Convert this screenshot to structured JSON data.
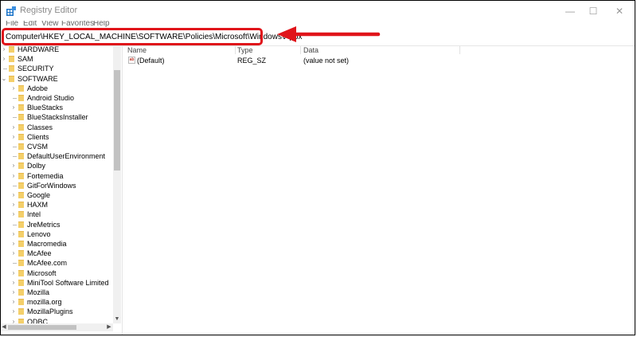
{
  "window": {
    "title": "Registry Editor",
    "icon": "registry-editor-icon",
    "controls": [
      "minimize",
      "maximize",
      "close"
    ],
    "control_glyphs": [
      "—",
      "☐",
      "✕"
    ]
  },
  "menu": [
    "File",
    "Edit",
    "View",
    "Favorites",
    "Help"
  ],
  "address": {
    "path": "Computer\\HKEY_LOCAL_MACHINE\\SOFTWARE\\Policies\\Microsoft\\Windows\\Appx"
  },
  "annotation": {
    "highlight_color": "#e0141a",
    "arrow_color": "#e0141a"
  },
  "tree": {
    "items": [
      {
        "label": "HARDWARE",
        "level": 1,
        "expander": "collapsed"
      },
      {
        "label": "SAM",
        "level": 1,
        "expander": "collapsed"
      },
      {
        "label": "SECURITY",
        "level": 1,
        "expander": "none"
      },
      {
        "label": "SOFTWARE",
        "level": 1,
        "expander": "expanded"
      },
      {
        "label": "Adobe",
        "level": 2,
        "expander": "collapsed"
      },
      {
        "label": "Android Studio",
        "level": 2,
        "expander": "none"
      },
      {
        "label": "BlueStacks",
        "level": 2,
        "expander": "collapsed"
      },
      {
        "label": "BlueStacksInstaller",
        "level": 2,
        "expander": "none"
      },
      {
        "label": "Classes",
        "level": 2,
        "expander": "collapsed"
      },
      {
        "label": "Clients",
        "level": 2,
        "expander": "collapsed"
      },
      {
        "label": "CVSM",
        "level": 2,
        "expander": "none"
      },
      {
        "label": "DefaultUserEnvironment",
        "level": 2,
        "expander": "none"
      },
      {
        "label": "Dolby",
        "level": 2,
        "expander": "collapsed"
      },
      {
        "label": "Fortemedia",
        "level": 2,
        "expander": "collapsed"
      },
      {
        "label": "GitForWindows",
        "level": 2,
        "expander": "none"
      },
      {
        "label": "Google",
        "level": 2,
        "expander": "collapsed"
      },
      {
        "label": "HAXM",
        "level": 2,
        "expander": "collapsed"
      },
      {
        "label": "Intel",
        "level": 2,
        "expander": "collapsed"
      },
      {
        "label": "JreMetrics",
        "level": 2,
        "expander": "none"
      },
      {
        "label": "Lenovo",
        "level": 2,
        "expander": "collapsed"
      },
      {
        "label": "Macromedia",
        "level": 2,
        "expander": "collapsed"
      },
      {
        "label": "McAfee",
        "level": 2,
        "expander": "collapsed"
      },
      {
        "label": "McAfee.com",
        "level": 2,
        "expander": "none"
      },
      {
        "label": "Microsoft",
        "level": 2,
        "expander": "collapsed"
      },
      {
        "label": "MiniTool Software Limited",
        "level": 2,
        "expander": "collapsed"
      },
      {
        "label": "Mozilla",
        "level": 2,
        "expander": "collapsed"
      },
      {
        "label": "mozilla.org",
        "level": 2,
        "expander": "collapsed"
      },
      {
        "label": "MozillaPlugins",
        "level": 2,
        "expander": "collapsed"
      },
      {
        "label": "ODBC",
        "level": 2,
        "expander": "collapsed"
      }
    ]
  },
  "list": {
    "columns": [
      "Name",
      "Type",
      "Data"
    ],
    "rows": [
      {
        "name": "(Default)",
        "type": "REG_SZ",
        "data": "(value not set)",
        "icon": "string-value-icon",
        "icon_text": "ab"
      }
    ]
  }
}
